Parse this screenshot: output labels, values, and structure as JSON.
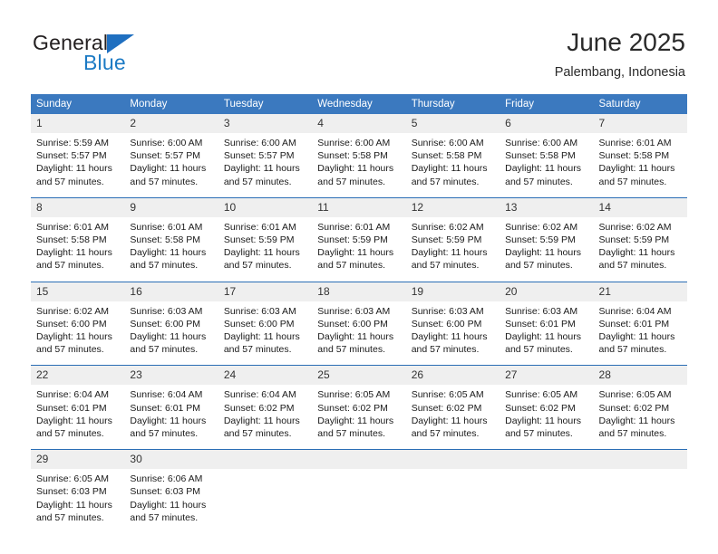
{
  "brand": {
    "name_top": "General",
    "name_bottom": "Blue",
    "color_dark": "#231f20",
    "color_blue": "#1b7ac4"
  },
  "header": {
    "title": "June 2025",
    "subtitle": "Palembang, Indonesia"
  },
  "theme": {
    "header_blue": "#3b79bf",
    "row_divider_blue": "#2a6db5",
    "daynum_band": "#efefef"
  },
  "weekday_headers": [
    "Sunday",
    "Monday",
    "Tuesday",
    "Wednesday",
    "Thursday",
    "Friday",
    "Saturday"
  ],
  "labels": {
    "sunrise_prefix": "Sunrise:",
    "sunset_prefix": "Sunset:",
    "daylight_prefix": "Daylight:"
  },
  "weeks": [
    [
      {
        "day": "1",
        "line1": "Sunrise: 5:59 AM",
        "line2": "Sunset: 5:57 PM",
        "line3": "Daylight: 11 hours",
        "line4": "and 57 minutes."
      },
      {
        "day": "2",
        "line1": "Sunrise: 6:00 AM",
        "line2": "Sunset: 5:57 PM",
        "line3": "Daylight: 11 hours",
        "line4": "and 57 minutes."
      },
      {
        "day": "3",
        "line1": "Sunrise: 6:00 AM",
        "line2": "Sunset: 5:57 PM",
        "line3": "Daylight: 11 hours",
        "line4": "and 57 minutes."
      },
      {
        "day": "4",
        "line1": "Sunrise: 6:00 AM",
        "line2": "Sunset: 5:58 PM",
        "line3": "Daylight: 11 hours",
        "line4": "and 57 minutes."
      },
      {
        "day": "5",
        "line1": "Sunrise: 6:00 AM",
        "line2": "Sunset: 5:58 PM",
        "line3": "Daylight: 11 hours",
        "line4": "and 57 minutes."
      },
      {
        "day": "6",
        "line1": "Sunrise: 6:00 AM",
        "line2": "Sunset: 5:58 PM",
        "line3": "Daylight: 11 hours",
        "line4": "and 57 minutes."
      },
      {
        "day": "7",
        "line1": "Sunrise: 6:01 AM",
        "line2": "Sunset: 5:58 PM",
        "line3": "Daylight: 11 hours",
        "line4": "and 57 minutes."
      }
    ],
    [
      {
        "day": "8",
        "line1": "Sunrise: 6:01 AM",
        "line2": "Sunset: 5:58 PM",
        "line3": "Daylight: 11 hours",
        "line4": "and 57 minutes."
      },
      {
        "day": "9",
        "line1": "Sunrise: 6:01 AM",
        "line2": "Sunset: 5:58 PM",
        "line3": "Daylight: 11 hours",
        "line4": "and 57 minutes."
      },
      {
        "day": "10",
        "line1": "Sunrise: 6:01 AM",
        "line2": "Sunset: 5:59 PM",
        "line3": "Daylight: 11 hours",
        "line4": "and 57 minutes."
      },
      {
        "day": "11",
        "line1": "Sunrise: 6:01 AM",
        "line2": "Sunset: 5:59 PM",
        "line3": "Daylight: 11 hours",
        "line4": "and 57 minutes."
      },
      {
        "day": "12",
        "line1": "Sunrise: 6:02 AM",
        "line2": "Sunset: 5:59 PM",
        "line3": "Daylight: 11 hours",
        "line4": "and 57 minutes."
      },
      {
        "day": "13",
        "line1": "Sunrise: 6:02 AM",
        "line2": "Sunset: 5:59 PM",
        "line3": "Daylight: 11 hours",
        "line4": "and 57 minutes."
      },
      {
        "day": "14",
        "line1": "Sunrise: 6:02 AM",
        "line2": "Sunset: 5:59 PM",
        "line3": "Daylight: 11 hours",
        "line4": "and 57 minutes."
      }
    ],
    [
      {
        "day": "15",
        "line1": "Sunrise: 6:02 AM",
        "line2": "Sunset: 6:00 PM",
        "line3": "Daylight: 11 hours",
        "line4": "and 57 minutes."
      },
      {
        "day": "16",
        "line1": "Sunrise: 6:03 AM",
        "line2": "Sunset: 6:00 PM",
        "line3": "Daylight: 11 hours",
        "line4": "and 57 minutes."
      },
      {
        "day": "17",
        "line1": "Sunrise: 6:03 AM",
        "line2": "Sunset: 6:00 PM",
        "line3": "Daylight: 11 hours",
        "line4": "and 57 minutes."
      },
      {
        "day": "18",
        "line1": "Sunrise: 6:03 AM",
        "line2": "Sunset: 6:00 PM",
        "line3": "Daylight: 11 hours",
        "line4": "and 57 minutes."
      },
      {
        "day": "19",
        "line1": "Sunrise: 6:03 AM",
        "line2": "Sunset: 6:00 PM",
        "line3": "Daylight: 11 hours",
        "line4": "and 57 minutes."
      },
      {
        "day": "20",
        "line1": "Sunrise: 6:03 AM",
        "line2": "Sunset: 6:01 PM",
        "line3": "Daylight: 11 hours",
        "line4": "and 57 minutes."
      },
      {
        "day": "21",
        "line1": "Sunrise: 6:04 AM",
        "line2": "Sunset: 6:01 PM",
        "line3": "Daylight: 11 hours",
        "line4": "and 57 minutes."
      }
    ],
    [
      {
        "day": "22",
        "line1": "Sunrise: 6:04 AM",
        "line2": "Sunset: 6:01 PM",
        "line3": "Daylight: 11 hours",
        "line4": "and 57 minutes."
      },
      {
        "day": "23",
        "line1": "Sunrise: 6:04 AM",
        "line2": "Sunset: 6:01 PM",
        "line3": "Daylight: 11 hours",
        "line4": "and 57 minutes."
      },
      {
        "day": "24",
        "line1": "Sunrise: 6:04 AM",
        "line2": "Sunset: 6:02 PM",
        "line3": "Daylight: 11 hours",
        "line4": "and 57 minutes."
      },
      {
        "day": "25",
        "line1": "Sunrise: 6:05 AM",
        "line2": "Sunset: 6:02 PM",
        "line3": "Daylight: 11 hours",
        "line4": "and 57 minutes."
      },
      {
        "day": "26",
        "line1": "Sunrise: 6:05 AM",
        "line2": "Sunset: 6:02 PM",
        "line3": "Daylight: 11 hours",
        "line4": "and 57 minutes."
      },
      {
        "day": "27",
        "line1": "Sunrise: 6:05 AM",
        "line2": "Sunset: 6:02 PM",
        "line3": "Daylight: 11 hours",
        "line4": "and 57 minutes."
      },
      {
        "day": "28",
        "line1": "Sunrise: 6:05 AM",
        "line2": "Sunset: 6:02 PM",
        "line3": "Daylight: 11 hours",
        "line4": "and 57 minutes."
      }
    ],
    [
      {
        "day": "29",
        "line1": "Sunrise: 6:05 AM",
        "line2": "Sunset: 6:03 PM",
        "line3": "Daylight: 11 hours",
        "line4": "and 57 minutes."
      },
      {
        "day": "30",
        "line1": "Sunrise: 6:06 AM",
        "line2": "Sunset: 6:03 PM",
        "line3": "Daylight: 11 hours",
        "line4": "and 57 minutes."
      },
      {
        "day": "",
        "line1": "",
        "line2": "",
        "line3": "",
        "line4": ""
      },
      {
        "day": "",
        "line1": "",
        "line2": "",
        "line3": "",
        "line4": ""
      },
      {
        "day": "",
        "line1": "",
        "line2": "",
        "line3": "",
        "line4": ""
      },
      {
        "day": "",
        "line1": "",
        "line2": "",
        "line3": "",
        "line4": ""
      },
      {
        "day": "",
        "line1": "",
        "line2": "",
        "line3": "",
        "line4": ""
      }
    ]
  ]
}
